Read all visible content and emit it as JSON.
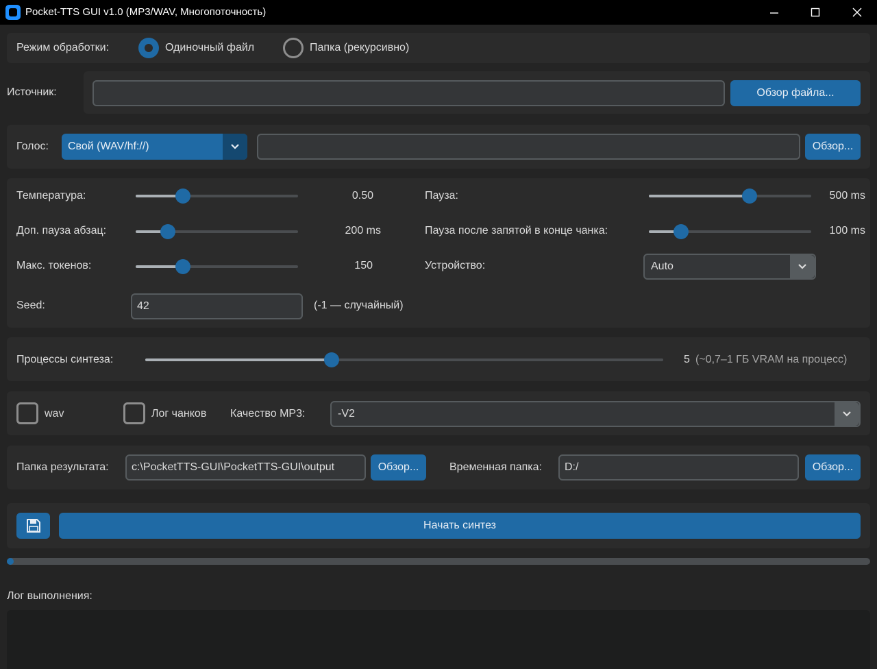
{
  "window": {
    "title": "Pocket-TTS GUI v1.0 (MP3/WAV, Многопоточность)",
    "accent_color": "#1f6aa5",
    "background_color": "#242424",
    "icons": {
      "app": "app-icon",
      "minimize": "minimize-icon",
      "maximize": "maximize-icon",
      "close": "close-icon"
    }
  },
  "mode": {
    "label": "Режим обработки:",
    "options": [
      {
        "label": "Одиночный файл",
        "selected": true
      },
      {
        "label": "Папка (рекурсивно)",
        "selected": false
      }
    ]
  },
  "source": {
    "label": "Источник:",
    "value": "",
    "browse_label": "Обзор файла..."
  },
  "voice": {
    "label": "Голос:",
    "selected": "Свой (WAV/hf://)",
    "path_value": "",
    "browse_label": "Обзор..."
  },
  "params": {
    "temperature": {
      "label": "Температура:",
      "value": "0.50",
      "level": 0.29
    },
    "pause": {
      "label": "Пауза:",
      "value": "500 ms",
      "level": 0.62
    },
    "paragraph_pause": {
      "label": "Доп. пауза абзац:",
      "value": "200 ms",
      "level": 0.2
    },
    "comma_pause": {
      "label": "Пауза после запятой в конце чанка:",
      "value": "100 ms",
      "level": 0.2
    },
    "max_tokens": {
      "label": "Макс. токенов:",
      "value": "150",
      "level": 0.29
    },
    "device": {
      "label": "Устройство:",
      "selected": "Auto"
    },
    "seed": {
      "label": "Seed:",
      "value": "42",
      "hint": "(-1 — случайный)"
    }
  },
  "processes": {
    "label": "Процессы синтеза:",
    "value": "5",
    "hint": "(~0,7–1 ГБ VRAM на процесс)",
    "level": 0.36
  },
  "output_options": {
    "wav_label": "wav",
    "wav_checked": false,
    "chunk_log_label": "Лог чанков",
    "chunk_log_checked": false,
    "mp3_quality_label": "Качество MP3:",
    "mp3_quality_selected": "-V2"
  },
  "folders": {
    "output_label": "Папка результата:",
    "output_value": "c:\\PocketTTS-GUI\\PocketTTS-GUI\\output",
    "output_browse": "Обзор...",
    "temp_label": "Временная папка:",
    "temp_value": "D:/",
    "temp_browse": "Обзор..."
  },
  "actions": {
    "save_icon": "save-icon",
    "start_label": "Начать синтез"
  },
  "progress": {
    "level": 0.008
  },
  "log": {
    "label": "Лог выполнения:",
    "content": ""
  }
}
